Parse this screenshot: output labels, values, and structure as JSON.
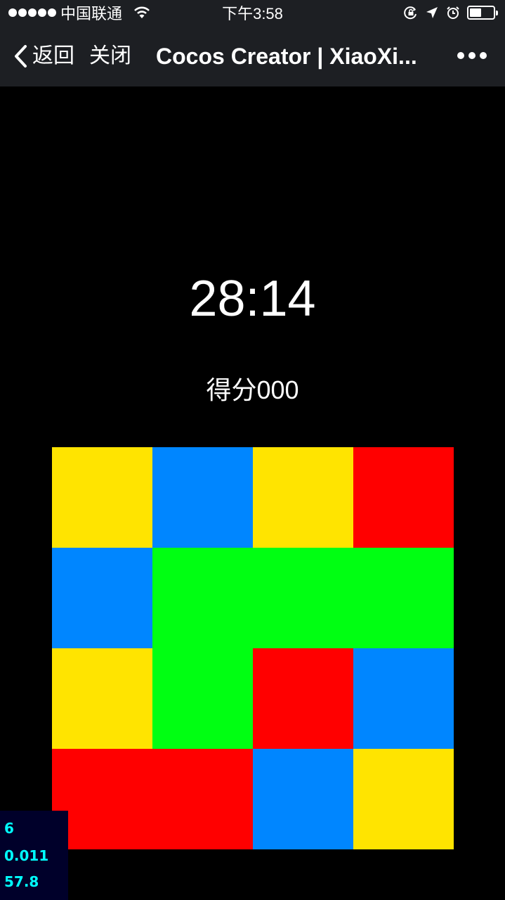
{
  "status_bar": {
    "carrier": "中国联通",
    "time": "下午3:58",
    "battery_level": 0.45,
    "icons": [
      "signal-icon",
      "wifi-icon",
      "orientation-lock-icon",
      "location-icon",
      "alarm-icon",
      "battery-icon"
    ]
  },
  "nav": {
    "back_label": "返回",
    "close_label": "关闭",
    "title": "Cocos Creator | XiaoXi...",
    "more_icon": "more-icon"
  },
  "game": {
    "timer": "28:14",
    "score_label": "得分",
    "score_value": "000",
    "grid": {
      "rows": 4,
      "cols": 4,
      "cells": [
        [
          "yellow",
          "blue",
          "yellow",
          "red"
        ],
        [
          "blue",
          "green",
          "green",
          "green"
        ],
        [
          "yellow",
          "green",
          "red",
          "blue"
        ],
        [
          "red",
          "red",
          "blue",
          "yellow"
        ]
      ]
    }
  },
  "colors": {
    "yellow": "#ffe400",
    "blue": "#0086ff",
    "red": "#ff0000",
    "green": "#00ff12",
    "topbar": "#1d1f23",
    "stats_text": "#00ffff"
  },
  "debug_stats": {
    "line1": "6",
    "line2": "0.011",
    "line3": "57.8"
  }
}
